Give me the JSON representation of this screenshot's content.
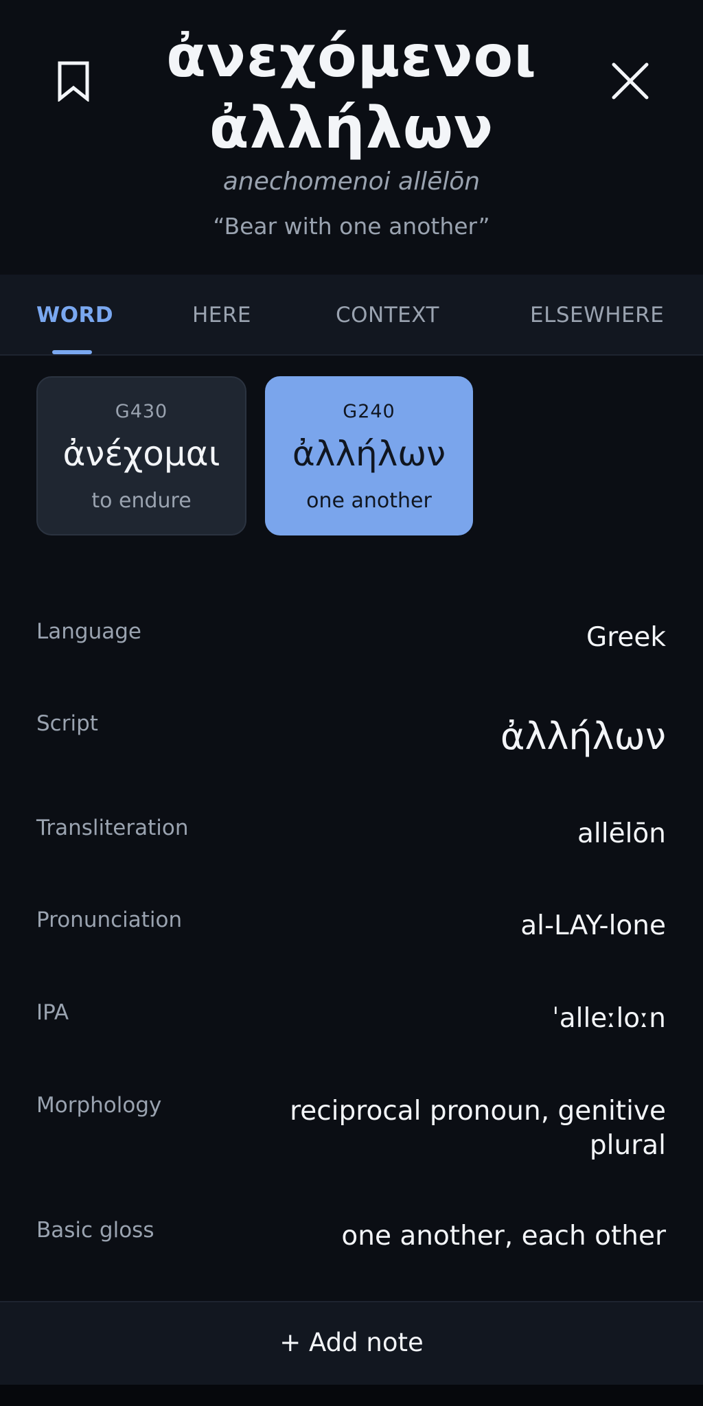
{
  "header": {
    "title_line1": "ἀνεχόμενοι",
    "title_line2": "ἀλλήλων",
    "transliteration": "anechomenoi allēlōn",
    "gloss": "“Bear with one another”",
    "bookmark_icon": "bookmark-icon",
    "close_icon": "close-icon"
  },
  "tabs": [
    {
      "label": "WORD",
      "active": true
    },
    {
      "label": "HERE",
      "active": false
    },
    {
      "label": "CONTEXT",
      "active": false
    },
    {
      "label": "ELSEWHERE",
      "active": false
    }
  ],
  "cards": [
    {
      "code": "G430",
      "lemma": "ἀνέχομαι",
      "gloss": "to endure",
      "selected": false
    },
    {
      "code": "G240",
      "lemma": "ἀλλήλων",
      "gloss": "one another",
      "selected": true
    }
  ],
  "details": {
    "language": {
      "label": "Language",
      "value": "Greek"
    },
    "script": {
      "label": "Script",
      "value": "ἀλλήλων"
    },
    "transliteration": {
      "label": "Transliteration",
      "value": "allēlōn"
    },
    "pronunciation": {
      "label": "Pronunciation",
      "value": "al-LAY-lone"
    },
    "ipa": {
      "label": "IPA",
      "value": "ˈalleːloːn"
    },
    "morphology": {
      "label": "Morphology",
      "value": "reciprocal pronoun, genitive plural"
    },
    "basic_gloss": {
      "label": "Basic gloss",
      "value": "one another, each other"
    }
  },
  "footer": {
    "add_note_label": "+ Add note"
  },
  "colors": {
    "background": "#0b0e14",
    "surface": "#121720",
    "accent": "#7aa8f0",
    "muted_text": "#9aa3b0",
    "primary_text": "#f3f5f8"
  }
}
